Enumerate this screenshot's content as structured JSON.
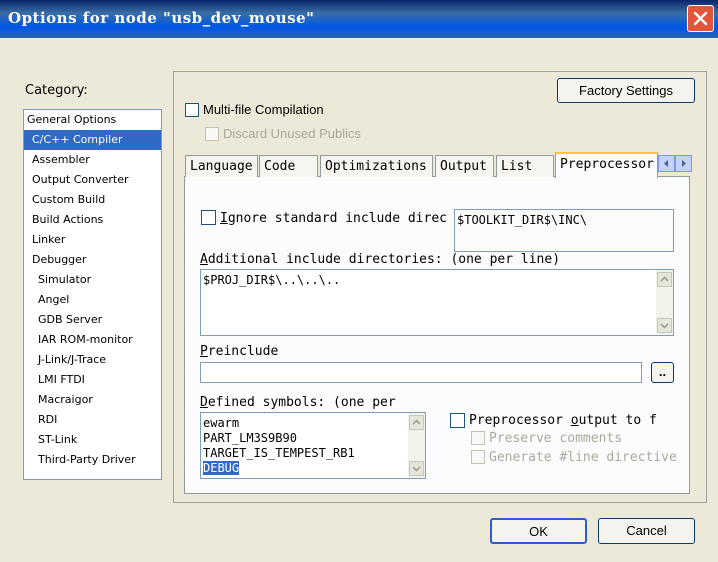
{
  "window": {
    "title": "Options for node \"usb_dev_mouse\""
  },
  "category": {
    "label": "Category:",
    "items": [
      {
        "label": "General Options",
        "indent": 0
      },
      {
        "label": "C/C++ Compiler",
        "indent": 1,
        "selected": true
      },
      {
        "label": "Assembler",
        "indent": 1
      },
      {
        "label": "Output Converter",
        "indent": 1
      },
      {
        "label": "Custom Build",
        "indent": 1
      },
      {
        "label": "Build Actions",
        "indent": 1
      },
      {
        "label": "Linker",
        "indent": 1
      },
      {
        "label": "Debugger",
        "indent": 1
      },
      {
        "label": "Simulator",
        "indent": 2
      },
      {
        "label": "Angel",
        "indent": 2
      },
      {
        "label": "GDB Server",
        "indent": 2
      },
      {
        "label": "IAR ROM-monitor",
        "indent": 2
      },
      {
        "label": "J-Link/J-Trace",
        "indent": 2
      },
      {
        "label": "LMI FTDI",
        "indent": 2
      },
      {
        "label": "Macraigor",
        "indent": 2
      },
      {
        "label": "RDI",
        "indent": 2
      },
      {
        "label": "ST-Link",
        "indent": 2
      },
      {
        "label": "Third-Party Driver",
        "indent": 2
      }
    ]
  },
  "panel": {
    "factory_settings": "Factory Settings",
    "multifile": "Multi-file Compilation",
    "discard_unused": "Discard Unused Publics",
    "tabs": [
      "Language",
      "Code",
      "Optimizations",
      "Output",
      "List",
      "Preprocessor"
    ],
    "ignore_std_prefix": "I",
    "ignore_std_rest": "gnore standard include direc",
    "toolkit_dir": "$TOOLKIT_DIR$\\INC\\",
    "additional_prefix": "A",
    "additional_rest": "dditional include directories: (one per line)",
    "additional_value": "$PROJ_DIR$\\..\\..\\..",
    "preinclude_prefix": "P",
    "preinclude_rest": "reinclude",
    "preinclude_value": "",
    "browse": "..",
    "defined_prefix": "D",
    "defined_rest": "efined symbols: (one per",
    "symbols": [
      "ewarm",
      "PART_LM3S9B90",
      "TARGET_IS_TEMPEST_RB1",
      "DEBUG"
    ],
    "pp_output_prefix": "Preprocessor ",
    "pp_output_u": "o",
    "pp_output_rest": "utput to f",
    "preserve_comments": "Preserve comments",
    "generate_line": "Generate #line directive"
  },
  "footer": {
    "ok": "OK",
    "cancel": "Cancel"
  }
}
